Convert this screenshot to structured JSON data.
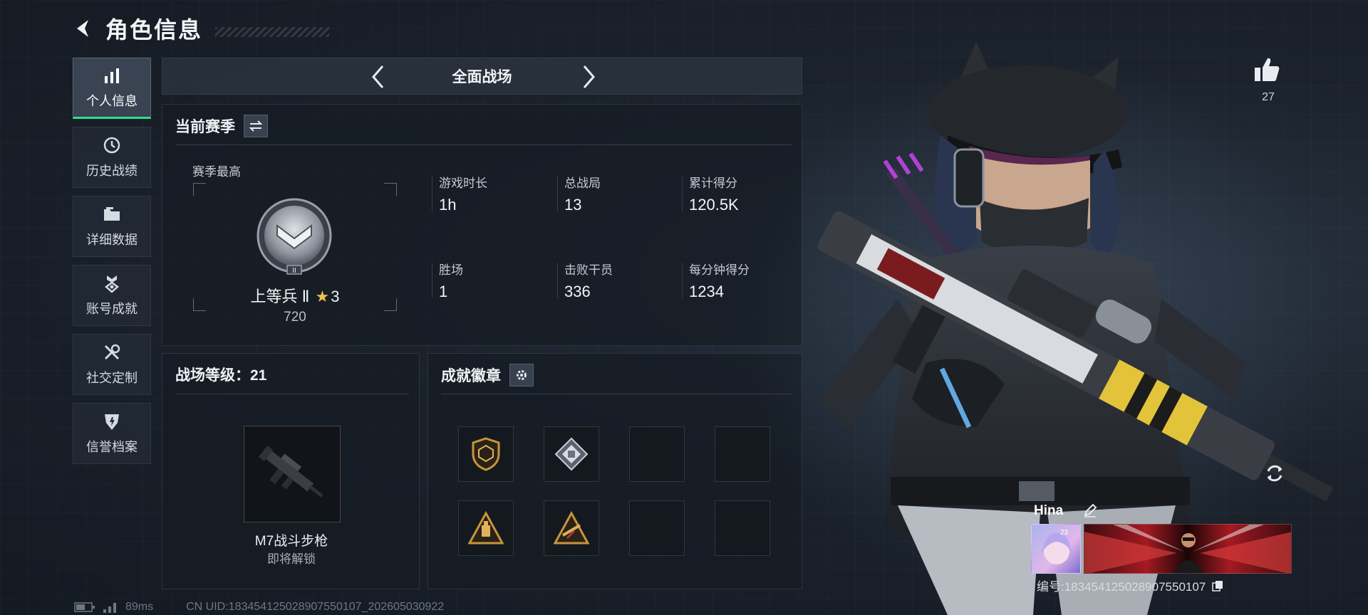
{
  "header": {
    "title": "角色信息"
  },
  "sidebar": {
    "items": [
      {
        "label": "个人信息",
        "icon": "bar-chart-icon",
        "active": true
      },
      {
        "label": "历史战绩",
        "icon": "history-clock-icon",
        "active": false
      },
      {
        "label": "详细数据",
        "icon": "folder-icon",
        "active": false
      },
      {
        "label": "账号成就",
        "icon": "medal-icon",
        "active": false
      },
      {
        "label": "社交定制",
        "icon": "wrench-icon",
        "active": false
      },
      {
        "label": "信誉档案",
        "icon": "shield-icon",
        "active": false
      }
    ]
  },
  "mode": {
    "name": "全面战场"
  },
  "season": {
    "title": "当前赛季",
    "best_label": "赛季最高",
    "rank_name": "上等兵 Ⅱ",
    "rank_stars": "3",
    "rank_score": "720",
    "rank_emblem_numeral": "II",
    "stats": [
      {
        "label": "游戏时长",
        "value": "1h"
      },
      {
        "label": "总战局",
        "value": "13"
      },
      {
        "label": "累计得分",
        "value": "120.5K"
      },
      {
        "label": "胜场",
        "value": "1"
      },
      {
        "label": "击败干员",
        "value": "336"
      },
      {
        "label": "每分钟得分",
        "value": "1234"
      }
    ]
  },
  "level": {
    "title": "战场等级：21",
    "weapon_name": "M7战斗步枪",
    "weapon_status": "即将解锁"
  },
  "badges": {
    "title": "成就徽章",
    "slots": [
      {
        "icon": "shield-badge-icon",
        "filled": true
      },
      {
        "icon": "diamond-badge-icon",
        "filled": true
      },
      {
        "icon": "",
        "filled": false
      },
      {
        "icon": "",
        "filled": false
      },
      {
        "icon": "triangle-badge-icon",
        "filled": true
      },
      {
        "icon": "triangle-rifle-badge-icon",
        "filled": true
      },
      {
        "icon": "",
        "filled": false
      },
      {
        "icon": "",
        "filled": false
      }
    ]
  },
  "player": {
    "name": "Hina",
    "like_count": "27",
    "id_text": "编号:1834541250289075501​07",
    "avatar_level": "23"
  },
  "footer": {
    "ping": "89ms",
    "uid": "CN UID:1834541250289075501​07_202605030922"
  },
  "colors": {
    "accent": "#2fe08a",
    "panel": "#161c24",
    "star": "#f2c14a",
    "badge_gold": "#c8953a"
  }
}
